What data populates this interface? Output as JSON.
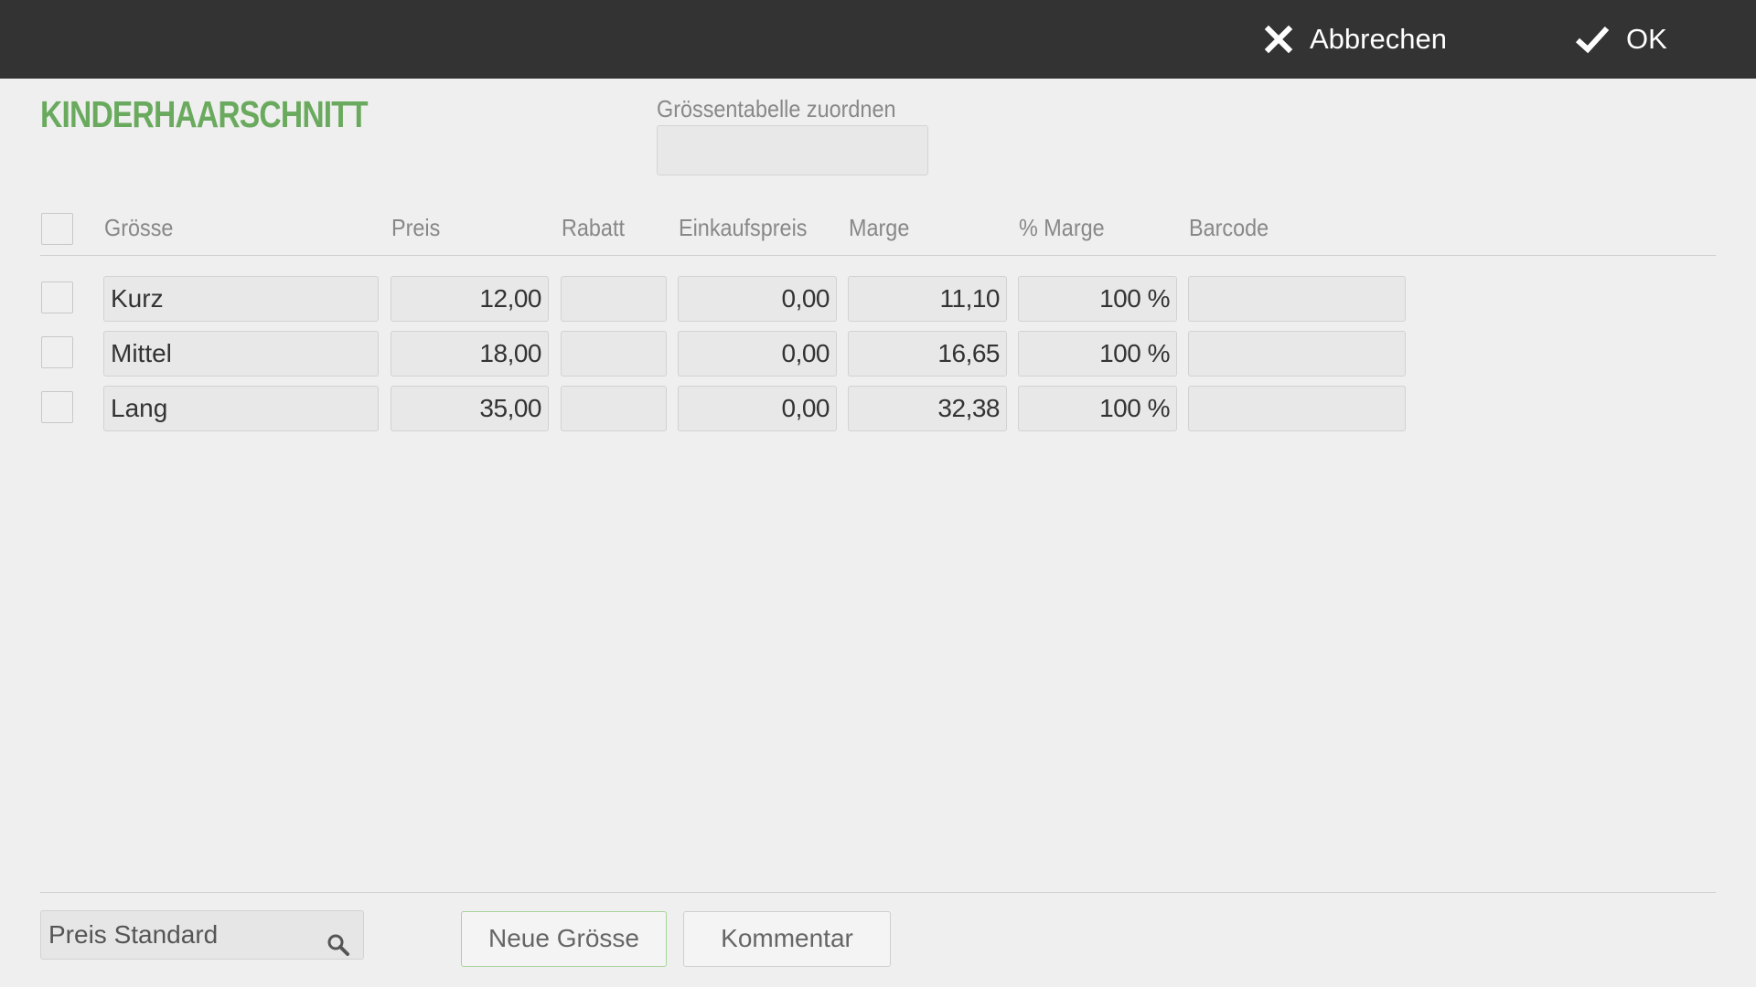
{
  "topbar": {
    "cancel_label": "Abbrechen",
    "cancel_icon": "close-icon",
    "ok_label": "OK",
    "ok_icon": "checkmark-icon"
  },
  "article_title": "KINDERHAARSCHNITT",
  "size_table": {
    "label": "Grössentabelle zuordnen",
    "value": ""
  },
  "table": {
    "columns": [
      "Grösse",
      "Preis",
      "Rabatt",
      "Einkaufspreis",
      "Marge",
      "% Marge",
      "Barcode"
    ],
    "rows": [
      {
        "size": "Kurz",
        "price": "12,00",
        "discount": "",
        "purchase_price": "0,00",
        "margin": "11,10",
        "margin_pct": "100 %",
        "barcode": ""
      },
      {
        "size": "Mittel",
        "price": "18,00",
        "discount": "",
        "purchase_price": "0,00",
        "margin": "16,65",
        "margin_pct": "100 %",
        "barcode": ""
      },
      {
        "size": "Lang",
        "price": "35,00",
        "discount": "",
        "purchase_price": "0,00",
        "margin": "32,38",
        "margin_pct": "100 %",
        "barcode": ""
      }
    ]
  },
  "footer": {
    "price_list": "Preis Standard",
    "price_list_icon": "search-icon",
    "new_size_label": "Neue Grösse",
    "comment_label": "Kommentar"
  },
  "colors": {
    "topbar": "#333333",
    "accent_green": "#6aaa5e",
    "background": "#efefef"
  }
}
